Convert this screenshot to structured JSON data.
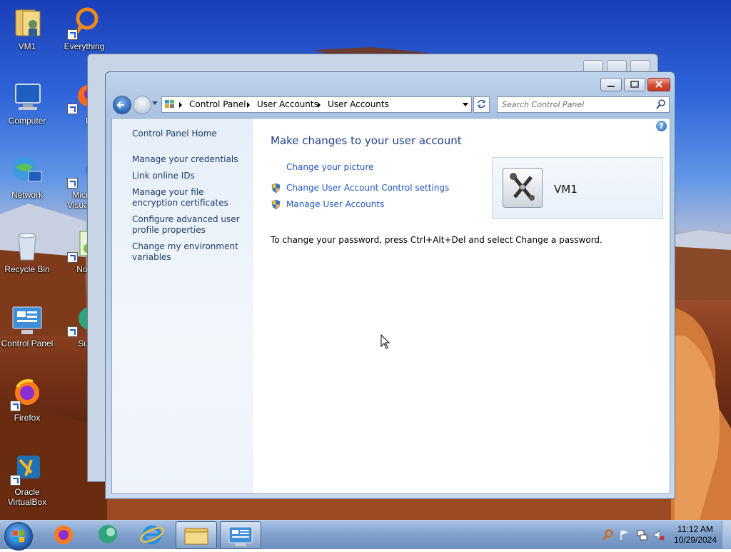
{
  "desktop": {
    "icons": [
      {
        "label": "VM1"
      },
      {
        "label": "Everything"
      },
      {
        "label": "Computer"
      },
      {
        "label": "Firef"
      },
      {
        "label": "Network"
      },
      {
        "label": "Micro Visual S"
      },
      {
        "label": "Recycle Bin"
      },
      {
        "label": "Notepa"
      },
      {
        "label": "Control Panel"
      },
      {
        "label": "Supern"
      },
      {
        "label": "Firefox"
      },
      {
        "label": "Oracle VirtualBox"
      }
    ]
  },
  "window": {
    "breadcrumb": [
      "Control Panel",
      "User Accounts",
      "User Accounts"
    ],
    "search_placeholder": "Search Control Panel",
    "help_glyph": "?",
    "sidebar": {
      "home": "Control Panel Home",
      "links": [
        "Manage your credentials",
        "Link online IDs",
        "Manage your file encryption certificates",
        "Configure advanced user profile properties",
        "Change my environment variables"
      ]
    },
    "main": {
      "heading": "Make changes to your user account",
      "tasks": [
        {
          "label": "Change your picture",
          "icon": "none"
        },
        {
          "label": "Change User Account Control settings",
          "icon": "shield-icon"
        },
        {
          "label": "Manage User Accounts",
          "icon": "shield-icon"
        }
      ],
      "password_note": "To change your password, press Ctrl+Alt+Del and select Change a password.",
      "user": {
        "name": "VM1"
      }
    }
  },
  "taskbar": {
    "clock_time": "11:12 AM",
    "clock_date": "10/29/2024",
    "pinned": [
      "firefox-icon",
      "supernote-icon",
      "internet-explorer-icon",
      "explorer-icon",
      "control-panel-icon"
    ]
  }
}
